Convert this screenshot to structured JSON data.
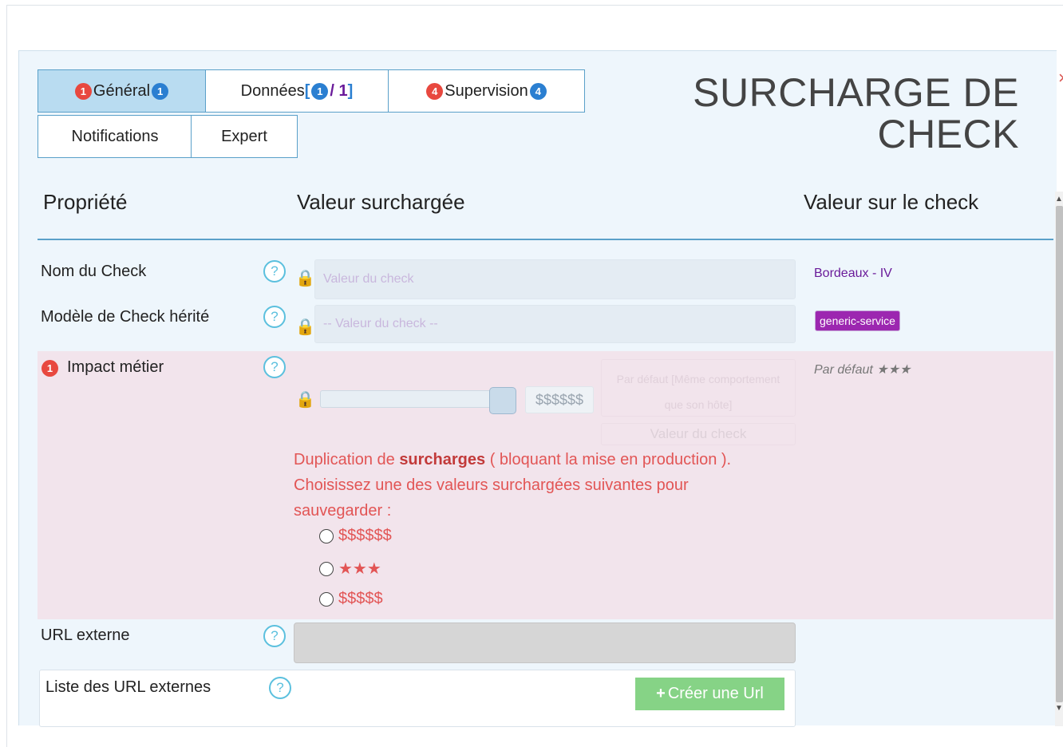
{
  "tabs": {
    "general": {
      "label": "Général",
      "badge_left": "1",
      "badge_right": "1"
    },
    "donnees": {
      "label": "Données",
      "open": "[",
      "count": "1",
      "sep": "/ 1",
      "close": "]"
    },
    "supervision": {
      "label": "Supervision",
      "badge_left": "4",
      "badge_right": "4"
    },
    "notifications": {
      "label": "Notifications"
    },
    "expert": {
      "label": "Expert"
    }
  },
  "title_line1": "SURCHARGE DE",
  "title_line2": "CHECK",
  "close_glyph": "×",
  "columns": {
    "property": "Propriété",
    "override": "Valeur surchargée",
    "check_value": "Valeur sur le check"
  },
  "help_glyph": "?",
  "rows": {
    "check_name": {
      "label": "Nom du Check",
      "placeholder": "Valeur du check",
      "check_value": "Bordeaux - IV"
    },
    "inherited_model": {
      "label": "Modèle de Check hérité",
      "placeholder": "-- Valeur du check --",
      "check_tag": "generic-service"
    },
    "impact": {
      "badge": "1",
      "label": "Impact métier",
      "slider_value": "$$$$$$",
      "faint_text": "Par défaut [Même comportement que son hôte]",
      "faint_button": "Valeur du check",
      "default_value": "Par défaut ★★★",
      "dup_pre": "Duplication de ",
      "dup_bold": "surcharges",
      "dup_post": " ( bloquant la mise en production ). Choisissez une des valeurs surchargées suivantes pour sauvegarder :",
      "options": [
        "$$$$$$",
        "★★★",
        "$$$$$"
      ]
    },
    "external_url": {
      "label": "URL externe"
    },
    "external_url_list": {
      "label": "Liste des URL externes",
      "create_button": "Créer une Url",
      "create_icon": "+"
    }
  }
}
